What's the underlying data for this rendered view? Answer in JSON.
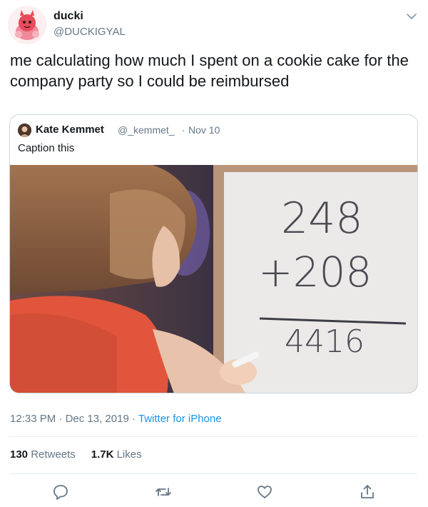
{
  "tweet": {
    "author_name": "ducki",
    "author_handle": "@DUCKIGYAL",
    "text": "me calculating how much I spent on a cookie cake for the company party so I could be reimbursed",
    "avatar_icon": "cartoon-devil-avatar-icon",
    "menu_icon": "chevron-down-icon"
  },
  "quote": {
    "author_name": "Kate Kemmet",
    "author_handle": "@_kemmet_",
    "separator": "·",
    "date": "Nov 10",
    "text": "Caption this",
    "image_description_icon": "girl-at-whiteboard-image",
    "whiteboard": {
      "line1": "248",
      "line2": "+208",
      "result": "4416"
    }
  },
  "meta": {
    "time": "12:33 PM",
    "separator": " · ",
    "date": "Dec 13, 2019",
    "separator2": " · ",
    "source": "Twitter for iPhone"
  },
  "stats": {
    "retweets_count": "130",
    "retweets_label": "Retweets",
    "likes_count": "1.7K",
    "likes_label": "Likes"
  },
  "actions": {
    "reply_icon": "reply-icon",
    "retweet_icon": "retweet-icon",
    "like_icon": "like-icon",
    "share_icon": "share-icon"
  },
  "colors": {
    "link": "#1b95e0",
    "muted": "#657786",
    "text": "#14171a",
    "border": "#ccd6dd"
  }
}
